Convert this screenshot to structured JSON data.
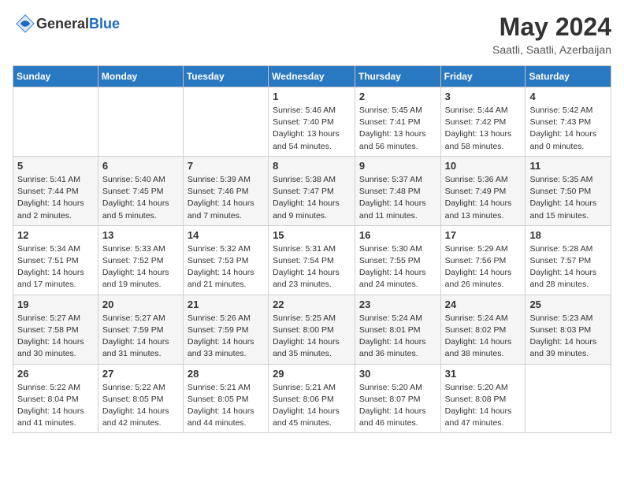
{
  "header": {
    "logo_general": "General",
    "logo_blue": "Blue",
    "month_year": "May 2024",
    "location": "Saatli, Saatli, Azerbaijan"
  },
  "days_of_week": [
    "Sunday",
    "Monday",
    "Tuesday",
    "Wednesday",
    "Thursday",
    "Friday",
    "Saturday"
  ],
  "weeks": [
    [
      null,
      null,
      null,
      {
        "day": "1",
        "sunrise": "Sunrise: 5:46 AM",
        "sunset": "Sunset: 7:40 PM",
        "daylight": "Daylight: 13 hours and 54 minutes."
      },
      {
        "day": "2",
        "sunrise": "Sunrise: 5:45 AM",
        "sunset": "Sunset: 7:41 PM",
        "daylight": "Daylight: 13 hours and 56 minutes."
      },
      {
        "day": "3",
        "sunrise": "Sunrise: 5:44 AM",
        "sunset": "Sunset: 7:42 PM",
        "daylight": "Daylight: 13 hours and 58 minutes."
      },
      {
        "day": "4",
        "sunrise": "Sunrise: 5:42 AM",
        "sunset": "Sunset: 7:43 PM",
        "daylight": "Daylight: 14 hours and 0 minutes."
      }
    ],
    [
      {
        "day": "5",
        "sunrise": "Sunrise: 5:41 AM",
        "sunset": "Sunset: 7:44 PM",
        "daylight": "Daylight: 14 hours and 2 minutes."
      },
      {
        "day": "6",
        "sunrise": "Sunrise: 5:40 AM",
        "sunset": "Sunset: 7:45 PM",
        "daylight": "Daylight: 14 hours and 5 minutes."
      },
      {
        "day": "7",
        "sunrise": "Sunrise: 5:39 AM",
        "sunset": "Sunset: 7:46 PM",
        "daylight": "Daylight: 14 hours and 7 minutes."
      },
      {
        "day": "8",
        "sunrise": "Sunrise: 5:38 AM",
        "sunset": "Sunset: 7:47 PM",
        "daylight": "Daylight: 14 hours and 9 minutes."
      },
      {
        "day": "9",
        "sunrise": "Sunrise: 5:37 AM",
        "sunset": "Sunset: 7:48 PM",
        "daylight": "Daylight: 14 hours and 11 minutes."
      },
      {
        "day": "10",
        "sunrise": "Sunrise: 5:36 AM",
        "sunset": "Sunset: 7:49 PM",
        "daylight": "Daylight: 14 hours and 13 minutes."
      },
      {
        "day": "11",
        "sunrise": "Sunrise: 5:35 AM",
        "sunset": "Sunset: 7:50 PM",
        "daylight": "Daylight: 14 hours and 15 minutes."
      }
    ],
    [
      {
        "day": "12",
        "sunrise": "Sunrise: 5:34 AM",
        "sunset": "Sunset: 7:51 PM",
        "daylight": "Daylight: 14 hours and 17 minutes."
      },
      {
        "day": "13",
        "sunrise": "Sunrise: 5:33 AM",
        "sunset": "Sunset: 7:52 PM",
        "daylight": "Daylight: 14 hours and 19 minutes."
      },
      {
        "day": "14",
        "sunrise": "Sunrise: 5:32 AM",
        "sunset": "Sunset: 7:53 PM",
        "daylight": "Daylight: 14 hours and 21 minutes."
      },
      {
        "day": "15",
        "sunrise": "Sunrise: 5:31 AM",
        "sunset": "Sunset: 7:54 PM",
        "daylight": "Daylight: 14 hours and 23 minutes."
      },
      {
        "day": "16",
        "sunrise": "Sunrise: 5:30 AM",
        "sunset": "Sunset: 7:55 PM",
        "daylight": "Daylight: 14 hours and 24 minutes."
      },
      {
        "day": "17",
        "sunrise": "Sunrise: 5:29 AM",
        "sunset": "Sunset: 7:56 PM",
        "daylight": "Daylight: 14 hours and 26 minutes."
      },
      {
        "day": "18",
        "sunrise": "Sunrise: 5:28 AM",
        "sunset": "Sunset: 7:57 PM",
        "daylight": "Daylight: 14 hours and 28 minutes."
      }
    ],
    [
      {
        "day": "19",
        "sunrise": "Sunrise: 5:27 AM",
        "sunset": "Sunset: 7:58 PM",
        "daylight": "Daylight: 14 hours and 30 minutes."
      },
      {
        "day": "20",
        "sunrise": "Sunrise: 5:27 AM",
        "sunset": "Sunset: 7:59 PM",
        "daylight": "Daylight: 14 hours and 31 minutes."
      },
      {
        "day": "21",
        "sunrise": "Sunrise: 5:26 AM",
        "sunset": "Sunset: 7:59 PM",
        "daylight": "Daylight: 14 hours and 33 minutes."
      },
      {
        "day": "22",
        "sunrise": "Sunrise: 5:25 AM",
        "sunset": "Sunset: 8:00 PM",
        "daylight": "Daylight: 14 hours and 35 minutes."
      },
      {
        "day": "23",
        "sunrise": "Sunrise: 5:24 AM",
        "sunset": "Sunset: 8:01 PM",
        "daylight": "Daylight: 14 hours and 36 minutes."
      },
      {
        "day": "24",
        "sunrise": "Sunrise: 5:24 AM",
        "sunset": "Sunset: 8:02 PM",
        "daylight": "Daylight: 14 hours and 38 minutes."
      },
      {
        "day": "25",
        "sunrise": "Sunrise: 5:23 AM",
        "sunset": "Sunset: 8:03 PM",
        "daylight": "Daylight: 14 hours and 39 minutes."
      }
    ],
    [
      {
        "day": "26",
        "sunrise": "Sunrise: 5:22 AM",
        "sunset": "Sunset: 8:04 PM",
        "daylight": "Daylight: 14 hours and 41 minutes."
      },
      {
        "day": "27",
        "sunrise": "Sunrise: 5:22 AM",
        "sunset": "Sunset: 8:05 PM",
        "daylight": "Daylight: 14 hours and 42 minutes."
      },
      {
        "day": "28",
        "sunrise": "Sunrise: 5:21 AM",
        "sunset": "Sunset: 8:05 PM",
        "daylight": "Daylight: 14 hours and 44 minutes."
      },
      {
        "day": "29",
        "sunrise": "Sunrise: 5:21 AM",
        "sunset": "Sunset: 8:06 PM",
        "daylight": "Daylight: 14 hours and 45 minutes."
      },
      {
        "day": "30",
        "sunrise": "Sunrise: 5:20 AM",
        "sunset": "Sunset: 8:07 PM",
        "daylight": "Daylight: 14 hours and 46 minutes."
      },
      {
        "day": "31",
        "sunrise": "Sunrise: 5:20 AM",
        "sunset": "Sunset: 8:08 PM",
        "daylight": "Daylight: 14 hours and 47 minutes."
      },
      null
    ]
  ]
}
